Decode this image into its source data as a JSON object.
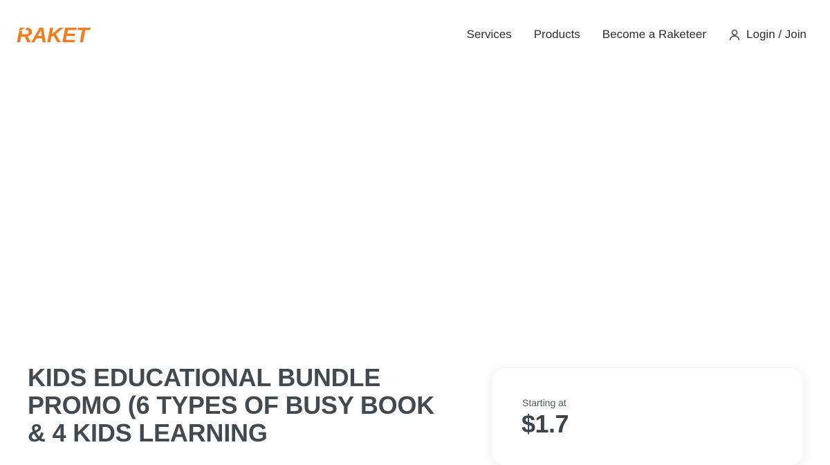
{
  "brand": {
    "logo_text": "RAKET",
    "accent_color": "#f47b20"
  },
  "nav": {
    "items": [
      {
        "label": "Services"
      },
      {
        "label": "Products"
      },
      {
        "label": "Become a Raketeer"
      }
    ],
    "login_icon": "user-icon",
    "login_label": "Login / Join"
  },
  "product": {
    "title": "KIDS EDUCATIONAL BUNDLE PROMO (6 TYPES OF BUSY BOOK & 4 KIDS LEARNING"
  },
  "pricing": {
    "starting_label": "Starting at",
    "price": "$1.7"
  }
}
